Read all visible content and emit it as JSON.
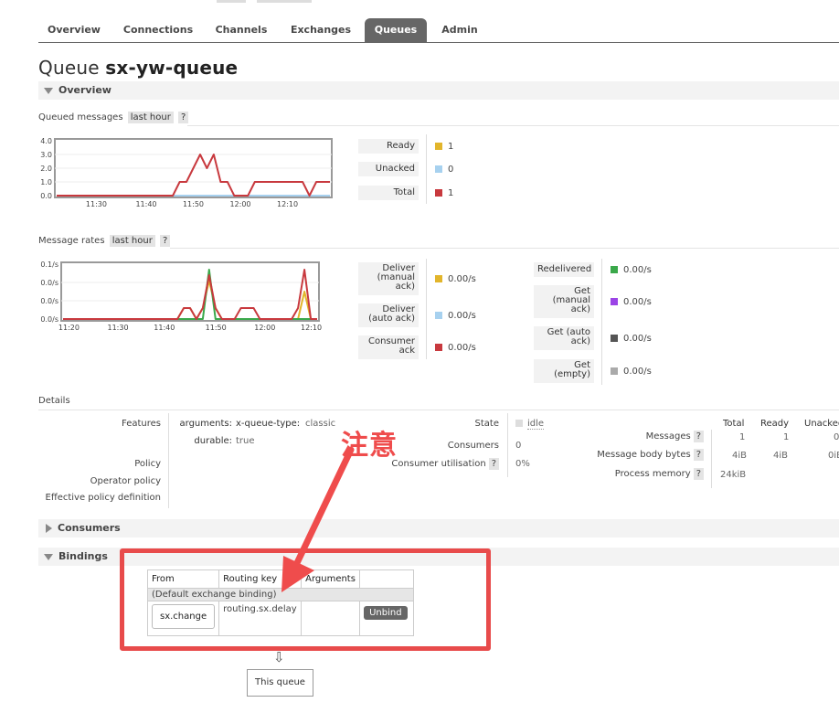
{
  "nav": {
    "tabs": [
      {
        "label": "Overview"
      },
      {
        "label": "Connections"
      },
      {
        "label": "Channels"
      },
      {
        "label": "Exchanges"
      },
      {
        "label": "Queues",
        "active": true
      },
      {
        "label": "Admin"
      }
    ]
  },
  "page": {
    "title_prefix": "Queue",
    "queue_name": "sx-yw-queue"
  },
  "sections": {
    "overview": "Overview",
    "consumers": "Consumers",
    "bindings": "Bindings"
  },
  "queued_messages": {
    "label": "Queued messages",
    "range": "last hour",
    "help": "?",
    "stats": [
      {
        "label": "Ready",
        "value": "1",
        "color": "#e2b52b"
      },
      {
        "label": "Unacked",
        "value": "0",
        "color": "#a7d1ef"
      },
      {
        "label": "Total",
        "value": "1",
        "color": "#c8393e"
      }
    ]
  },
  "message_rates": {
    "label": "Message rates",
    "range": "last hour",
    "help": "?",
    "stats_left": [
      {
        "label": "Deliver (manual ack)",
        "value": "0.00/s",
        "color": "#e2b52b"
      },
      {
        "label": "Deliver (auto ack)",
        "value": "0.00/s",
        "color": "#a7d1ef"
      },
      {
        "label": "Consumer ack",
        "value": "0.00/s",
        "color": "#c8393e"
      }
    ],
    "stats_right": [
      {
        "label": "Redelivered",
        "value": "0.00/s",
        "color": "#3aa84a"
      },
      {
        "label": "Get (manual ack)",
        "value": "0.00/s",
        "color": "#9b44e6"
      },
      {
        "label": "Get (auto ack)",
        "value": "0.00/s",
        "color": "#555555"
      },
      {
        "label": "Get (empty)",
        "value": "0.00/s",
        "color": "#aaaaaa"
      }
    ]
  },
  "chart_data": [
    {
      "type": "line",
      "title": "Queued messages",
      "ylim": [
        0,
        4
      ],
      "yticks": [
        "4.0",
        "3.0",
        "2.0",
        "1.0",
        "0.0"
      ],
      "xticks": [
        "11:30",
        "11:40",
        "11:50",
        "12:00",
        "12:10"
      ],
      "x": [
        0,
        1,
        2,
        3,
        4,
        5,
        6,
        7,
        8,
        9,
        10,
        11,
        12,
        13,
        14,
        15,
        16,
        17,
        18,
        19,
        20,
        21,
        22,
        23,
        24,
        25,
        26,
        27,
        28,
        29,
        30,
        31,
        32,
        33,
        34,
        35,
        36,
        37,
        38,
        39,
        40
      ],
      "series": [
        {
          "name": "Ready",
          "color": "#e2b52b",
          "values": [
            0,
            0,
            0,
            0,
            0,
            0,
            0,
            0,
            0,
            0,
            0,
            0,
            0,
            0,
            0,
            0,
            0,
            0,
            0,
            0,
            0,
            0,
            0,
            0,
            0,
            0,
            0,
            0,
            0,
            0,
            0,
            0,
            0,
            0,
            0,
            0,
            0,
            0,
            0,
            0,
            0
          ]
        },
        {
          "name": "Unacked",
          "color": "#a7d1ef",
          "values": [
            0,
            0,
            0,
            0,
            0,
            0,
            0,
            0,
            0,
            0,
            0,
            0,
            0,
            0,
            0,
            0,
            0,
            0,
            0,
            0,
            0,
            0,
            0,
            0,
            0,
            0,
            0,
            0,
            0,
            0,
            0,
            0,
            0,
            0,
            0,
            0,
            0,
            0,
            0,
            0,
            0
          ]
        },
        {
          "name": "Total",
          "color": "#c8393e",
          "values": [
            0,
            0,
            0,
            0,
            0,
            0,
            0,
            0,
            0,
            0,
            0,
            0,
            0,
            0,
            0,
            0,
            0,
            0,
            1,
            1,
            2,
            3,
            2,
            3,
            1,
            1,
            0,
            0,
            0,
            1,
            1,
            1,
            1,
            1,
            1,
            1,
            1,
            0,
            1,
            1,
            1
          ]
        }
      ]
    },
    {
      "type": "line",
      "title": "Message rates",
      "ylim": [
        0,
        0.1
      ],
      "yticks": [
        "0.1/s",
        "0.0/s",
        "0.0/s",
        "0.0/s"
      ],
      "xticks": [
        "11:20",
        "11:30",
        "11:40",
        "11:50",
        "12:00",
        "12:10"
      ],
      "x": [
        0,
        1,
        2,
        3,
        4,
        5,
        6,
        7,
        8,
        9,
        10,
        11,
        12,
        13,
        14,
        15,
        16,
        17,
        18,
        19,
        20,
        21,
        22,
        23,
        24,
        25,
        26,
        27,
        28,
        29,
        30,
        31,
        32,
        33,
        34,
        35,
        36,
        37,
        38,
        39,
        40
      ],
      "series": [
        {
          "name": "Deliver (manual ack)",
          "color": "#e2b52b",
          "values": [
            0,
            0,
            0,
            0,
            0,
            0,
            0,
            0,
            0,
            0,
            0,
            0,
            0,
            0,
            0,
            0,
            0,
            0,
            0,
            0.02,
            0.02,
            0,
            0.02,
            0.07,
            0.02,
            0,
            0,
            0,
            0,
            0,
            0,
            0,
            0,
            0,
            0,
            0,
            0,
            0,
            0.05,
            0,
            0
          ]
        },
        {
          "name": "Redelivered",
          "color": "#3aa84a",
          "values": [
            0,
            0,
            0,
            0,
            0,
            0,
            0,
            0,
            0,
            0,
            0,
            0,
            0,
            0,
            0,
            0,
            0,
            0,
            0,
            0,
            0,
            0,
            0,
            0.09,
            0,
            0,
            0,
            0,
            0,
            0,
            0,
            0,
            0,
            0,
            0,
            0,
            0,
            0,
            0,
            0,
            0
          ]
        },
        {
          "name": "Consumer ack",
          "color": "#c8393e",
          "values": [
            0,
            0,
            0,
            0,
            0,
            0,
            0,
            0,
            0,
            0,
            0,
            0,
            0,
            0,
            0,
            0,
            0,
            0,
            0,
            0.02,
            0.02,
            0,
            0.02,
            0.08,
            0.02,
            0,
            0,
            0,
            0.02,
            0.02,
            0.02,
            0,
            0,
            0,
            0,
            0,
            0,
            0.02,
            0.09,
            0,
            0
          ]
        }
      ]
    }
  ],
  "details": {
    "label": "Details",
    "features_label": "Features",
    "arguments_label": "arguments:",
    "arg_key": "x-queue-type:",
    "arg_val": "classic",
    "durable_label": "durable:",
    "durable_val": "true",
    "policy_label": "Policy",
    "operator_policy_label": "Operator policy",
    "effective_policy_label": "Effective policy definition",
    "state_label": "State",
    "state_val": "idle",
    "consumers_label": "Consumers",
    "consumers_val": "0",
    "util_label": "Consumer utilisation",
    "util_help": "?",
    "util_val": "0%",
    "col_total": "Total",
    "col_ready": "Ready",
    "col_unacked": "Unacked",
    "messages_label": "Messages",
    "messages_help": "?",
    "messages_total": "1",
    "messages_ready": "1",
    "messages_unacked": "0",
    "body_label": "Message body bytes",
    "body_help": "?",
    "body_total": "4iB",
    "body_ready": "4iB",
    "body_unacked": "0iB",
    "memory_label": "Process memory",
    "memory_help": "?",
    "memory_val": "24kiB"
  },
  "bindings": {
    "headers": [
      "From",
      "Routing key",
      "Arguments",
      ""
    ],
    "default_binding": "(Default exchange binding)",
    "source": "sx.change",
    "routing_key": "routing.sx.delay",
    "unbind_label": "Unbind",
    "arrow": "⇩",
    "this_queue": "This queue"
  },
  "annotation": {
    "text": "注意",
    "color": "#ef4c4c"
  }
}
